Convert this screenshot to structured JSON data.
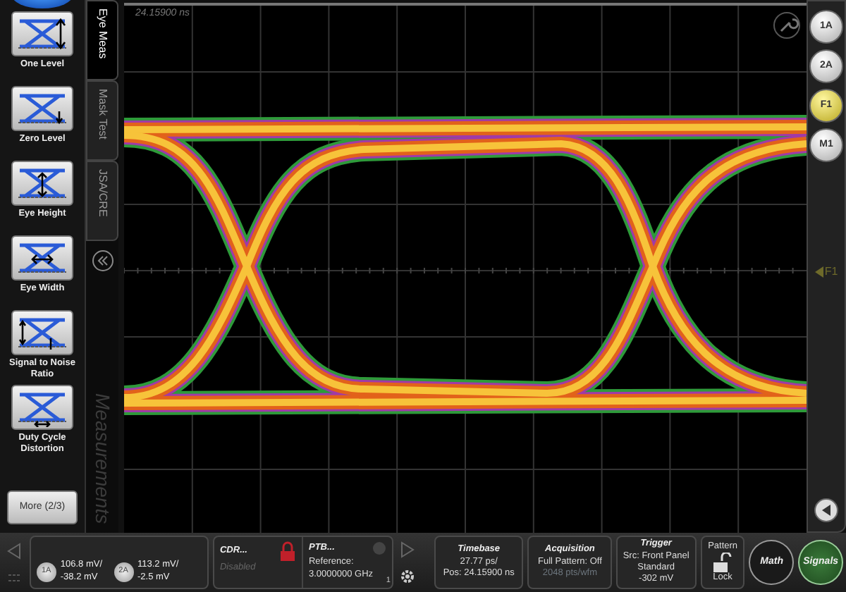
{
  "measurements": [
    {
      "label": "One Level"
    },
    {
      "label": "Zero Level"
    },
    {
      "label": "Eye Height"
    },
    {
      "label": "Eye Width"
    },
    {
      "label": "Signal to Noise Ratio"
    },
    {
      "label": "Duty Cycle Distortion"
    }
  ],
  "more_button": "More (2/3)",
  "side_tabs": [
    {
      "label": "Eye Meas",
      "selected": true
    },
    {
      "label": "Mask Test",
      "selected": false
    },
    {
      "label": "JSA/CRE",
      "selected": false
    }
  ],
  "panel_title": "Measurements",
  "plot": {
    "timestamp": "24.15900 ns"
  },
  "right_buttons": [
    {
      "label": "1A",
      "selected": false
    },
    {
      "label": "2A",
      "selected": false
    },
    {
      "label": "F1",
      "selected": true
    },
    {
      "label": "M1",
      "selected": false
    }
  ],
  "marker": {
    "label": "F1"
  },
  "channels": [
    {
      "badge": "1A",
      "scale": "106.8 mV/",
      "offset": "-38.2 mV"
    },
    {
      "badge": "2A",
      "scale": "113.2 mV/",
      "offset": "-2.5 mV"
    }
  ],
  "cdr": {
    "title": "CDR...",
    "status": "Disabled",
    "locked": true
  },
  "ptb": {
    "title": "PTB...",
    "label": "Reference:",
    "value": "3.0000000 GHz",
    "corner": "1"
  },
  "timebase": {
    "title": "Timebase",
    "scale": "27.77 ps/",
    "position": "Pos: 24.15900 ns"
  },
  "acquisition": {
    "title": "Acquisition",
    "mode": "Full Pattern: Off",
    "record": "2048 pts/wfm"
  },
  "trigger": {
    "title": "Trigger",
    "source": "Src: Front Panel",
    "type": "Standard",
    "level": "-302 mV"
  },
  "pattern_lock": {
    "top": "Pattern",
    "bottom": "Lock",
    "locked": false
  },
  "math_button": "Math",
  "signals_button": "Signals"
}
